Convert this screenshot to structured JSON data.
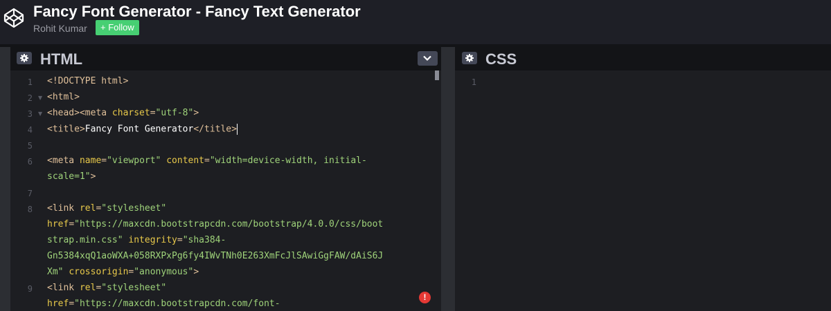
{
  "header": {
    "title": "Fancy Font Generator - Fancy Text Generator",
    "author": "Rohit Kumar",
    "follow_label": "+ Follow"
  },
  "html_panel": {
    "title": "HTML",
    "lines": [
      {
        "num": "1",
        "parts": [
          {
            "c": "tag",
            "t": "<!DOCTYPE html>"
          }
        ]
      },
      {
        "num": "2",
        "fold": true,
        "parts": [
          {
            "c": "tag",
            "t": "<html>"
          }
        ]
      },
      {
        "num": "3",
        "fold": true,
        "parts": [
          {
            "c": "tag",
            "t": "<head><meta "
          },
          {
            "c": "attr",
            "t": "charset"
          },
          {
            "c": "tag",
            "t": "="
          },
          {
            "c": "str",
            "t": "\"utf-8\""
          },
          {
            "c": "tag",
            "t": ">"
          }
        ]
      },
      {
        "num": "4",
        "parts": [
          {
            "c": "tag",
            "t": "<title>"
          },
          {
            "c": "txt",
            "t": "Fancy Font Generator"
          },
          {
            "c": "tag",
            "t": "</title>"
          }
        ],
        "cursor": true
      },
      {
        "num": "5",
        "parts": []
      },
      {
        "num": "6",
        "parts": [
          {
            "c": "tag",
            "t": "<meta "
          },
          {
            "c": "attr",
            "t": "name"
          },
          {
            "c": "tag",
            "t": "="
          },
          {
            "c": "str",
            "t": "\"viewport\""
          },
          {
            "c": "tag",
            "t": " "
          },
          {
            "c": "attr",
            "t": "content"
          },
          {
            "c": "tag",
            "t": "="
          },
          {
            "c": "str",
            "t": "\"width=device-width, initial-"
          }
        ]
      },
      {
        "num": "",
        "parts": [
          {
            "c": "str",
            "t": "scale=1\""
          },
          {
            "c": "tag",
            "t": ">"
          }
        ]
      },
      {
        "num": "7",
        "parts": []
      },
      {
        "num": "8",
        "parts": [
          {
            "c": "tag",
            "t": "<link "
          },
          {
            "c": "attr",
            "t": "rel"
          },
          {
            "c": "tag",
            "t": "="
          },
          {
            "c": "str",
            "t": "\"stylesheet\""
          }
        ]
      },
      {
        "num": "",
        "parts": [
          {
            "c": "attr",
            "t": "href"
          },
          {
            "c": "tag",
            "t": "="
          },
          {
            "c": "str",
            "t": "\"https://maxcdn.bootstrapcdn.com/bootstrap/4.0.0/css/boot"
          }
        ]
      },
      {
        "num": "",
        "parts": [
          {
            "c": "str",
            "t": "strap.min.css\""
          },
          {
            "c": "tag",
            "t": " "
          },
          {
            "c": "attr",
            "t": "integrity"
          },
          {
            "c": "tag",
            "t": "="
          },
          {
            "c": "str",
            "t": "\"sha384-"
          }
        ]
      },
      {
        "num": "",
        "parts": [
          {
            "c": "str",
            "t": "Gn5384xqQ1aoWXA+058RXPxPg6fy4IWvTNh0E263XmFcJlSAwiGgFAW/dAiS6J"
          }
        ]
      },
      {
        "num": "",
        "parts": [
          {
            "c": "str",
            "t": "Xm\""
          },
          {
            "c": "tag",
            "t": " "
          },
          {
            "c": "attr",
            "t": "crossorigin"
          },
          {
            "c": "tag",
            "t": "="
          },
          {
            "c": "str",
            "t": "\"anonymous\""
          },
          {
            "c": "tag",
            "t": ">"
          }
        ]
      },
      {
        "num": "9",
        "parts": [
          {
            "c": "tag",
            "t": "<link "
          },
          {
            "c": "attr",
            "t": "rel"
          },
          {
            "c": "tag",
            "t": "="
          },
          {
            "c": "str",
            "t": "\"stylesheet\""
          }
        ]
      },
      {
        "num": "",
        "parts": [
          {
            "c": "attr",
            "t": "href"
          },
          {
            "c": "tag",
            "t": "="
          },
          {
            "c": "str",
            "t": "\"https://maxcdn.bootstrapcdn.com/font-"
          }
        ]
      }
    ]
  },
  "css_panel": {
    "title": "CSS",
    "lines": [
      {
        "num": "1"
      }
    ]
  },
  "error_badge": "!"
}
